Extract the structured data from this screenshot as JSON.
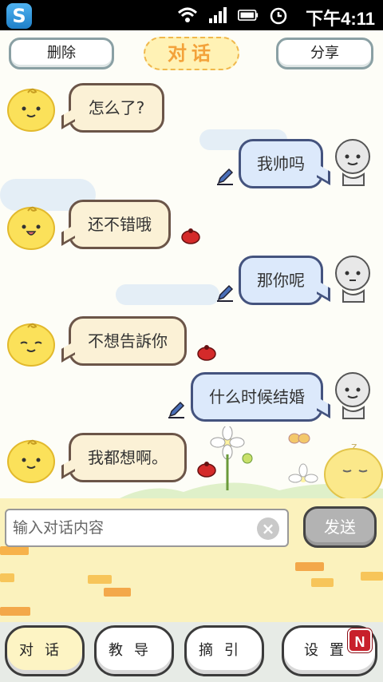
{
  "status_bar": {
    "app_icon_letter": "S",
    "time": "下午4:11",
    "icons": [
      "wifi-icon",
      "signal-icon",
      "battery-icon",
      "alarm-clock-icon"
    ]
  },
  "top_bar": {
    "delete_label": "删除",
    "title": "对话",
    "share_label": "分享"
  },
  "messages": [
    {
      "side": "left",
      "text": "怎么了?"
    },
    {
      "side": "right",
      "text": "我帅吗"
    },
    {
      "side": "left",
      "text": "还不错哦"
    },
    {
      "side": "right",
      "text": "那你呢"
    },
    {
      "side": "left",
      "text": "不想告訴你"
    },
    {
      "side": "right",
      "text": "什么时候结婚"
    },
    {
      "side": "left",
      "text": "我都想啊。"
    }
  ],
  "input": {
    "placeholder": "输入对话内容",
    "value": "",
    "send_label": "发送"
  },
  "tabs": [
    {
      "label": "对话",
      "active": true
    },
    {
      "label": "教导",
      "active": false
    },
    {
      "label": "摘引",
      "active": false
    },
    {
      "label": "设置",
      "active": false
    }
  ],
  "notification_badge": "N",
  "colors": {
    "title_accent": "#f3a23a",
    "user_bubble": "#fbf1d6",
    "bot_bubble": "#dce9fb",
    "badge": "#c8202b"
  }
}
